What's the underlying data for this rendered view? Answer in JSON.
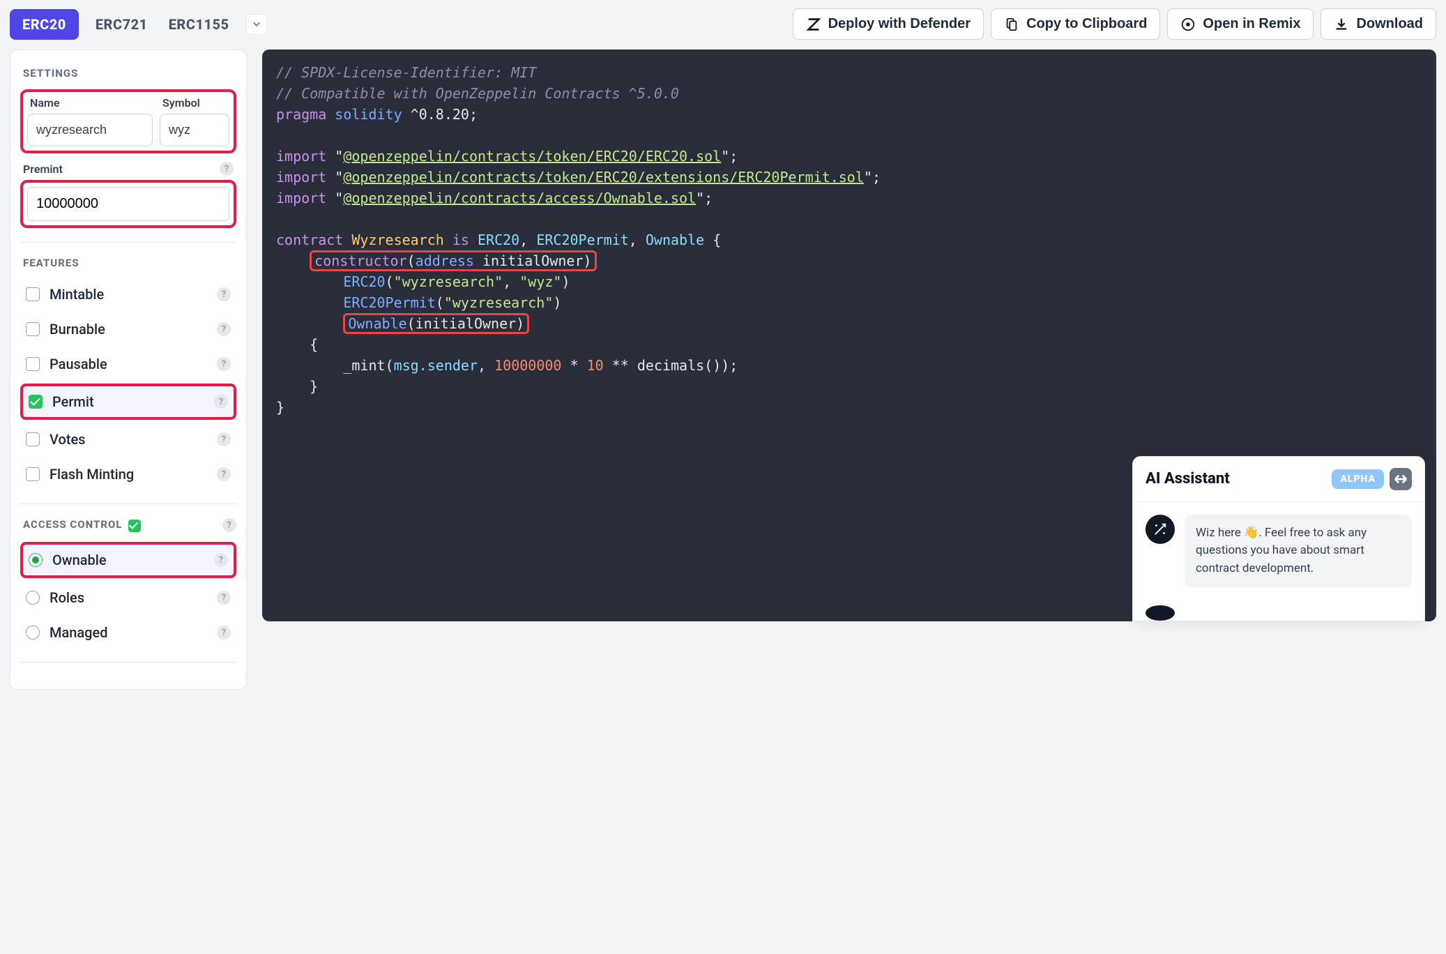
{
  "tabs": {
    "t1": "ERC20",
    "t2": "ERC721",
    "t3": "ERC1155"
  },
  "actions": {
    "deploy": "Deploy with Defender",
    "copy": "Copy to Clipboard",
    "remix": "Open in Remix",
    "download": "Download"
  },
  "settings": {
    "heading": "SETTINGS",
    "name_label": "Name",
    "name_value": "wyzresearch",
    "symbol_label": "Symbol",
    "symbol_value": "wyz",
    "premint_label": "Premint",
    "premint_value": "10000000"
  },
  "features": {
    "heading": "FEATURES",
    "items": [
      "Mintable",
      "Burnable",
      "Pausable",
      "Permit",
      "Votes",
      "Flash Minting"
    ]
  },
  "access_control": {
    "heading": "ACCESS CONTROL",
    "items": [
      "Ownable",
      "Roles",
      "Managed"
    ]
  },
  "code": {
    "c1": "// SPDX-License-Identifier: MIT",
    "c2": "// Compatible with OpenZeppelin Contracts ^5.0.0",
    "pragma_k": "pragma",
    "pragma_sol": "solidity",
    "pragma_v": "^0.8.20",
    "import_k": "import",
    "imp1": "@openzeppelin/contracts/token/ERC20/ERC20.sol",
    "imp2": "@openzeppelin/contracts/token/ERC20/extensions/ERC20Permit.sol",
    "imp3": "@openzeppelin/contracts/access/Ownable.sol",
    "contract_k": "contract",
    "contract_name": "Wyzresearch",
    "is_k": "is",
    "base1": "ERC20",
    "base2": "ERC20Permit",
    "base3": "Ownable",
    "ctor_k": "constructor",
    "addr_k": "address",
    "param": "initialOwner",
    "erc20_call": "ERC20",
    "erc20_a1": "\"wyzresearch\"",
    "erc20_a2": "\"wyz\"",
    "permit_call": "ERC20Permit",
    "permit_a1": "\"wyzresearch\"",
    "own_call": "Ownable",
    "own_a1": "initialOwner",
    "mint_fn": "_mint",
    "msg_sender": "msg.sender",
    "mint_num": "10000000",
    "mint_mul": "10",
    "decimals_fn": "decimals"
  },
  "ai": {
    "title": "AI Assistant",
    "badge": "ALPHA",
    "message": "Wiz here 👋. Feel free to ask any questions you have about smart contract development."
  }
}
